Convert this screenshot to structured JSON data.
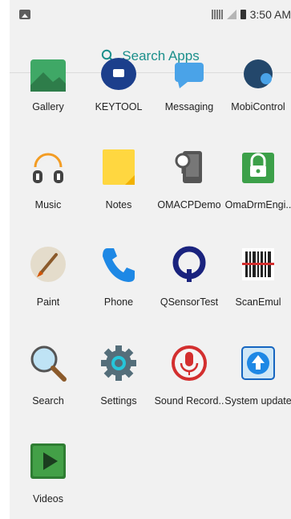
{
  "status": {
    "time": "3:50 AM"
  },
  "search": {
    "label": "Search Apps"
  },
  "apps": [
    {
      "label": "Gallery"
    },
    {
      "label": "KEYTOOL"
    },
    {
      "label": "Messaging"
    },
    {
      "label": "MobiControl"
    },
    {
      "label": "Music"
    },
    {
      "label": "Notes"
    },
    {
      "label": "OMACPDemo"
    },
    {
      "label": "OmaDrmEngi.."
    },
    {
      "label": "Paint"
    },
    {
      "label": "Phone"
    },
    {
      "label": "QSensorTest"
    },
    {
      "label": "ScanEmul"
    },
    {
      "label": "Search"
    },
    {
      "label": "Settings"
    },
    {
      "label": "Sound Record.."
    },
    {
      "label": "System update"
    },
    {
      "label": "Videos"
    }
  ]
}
